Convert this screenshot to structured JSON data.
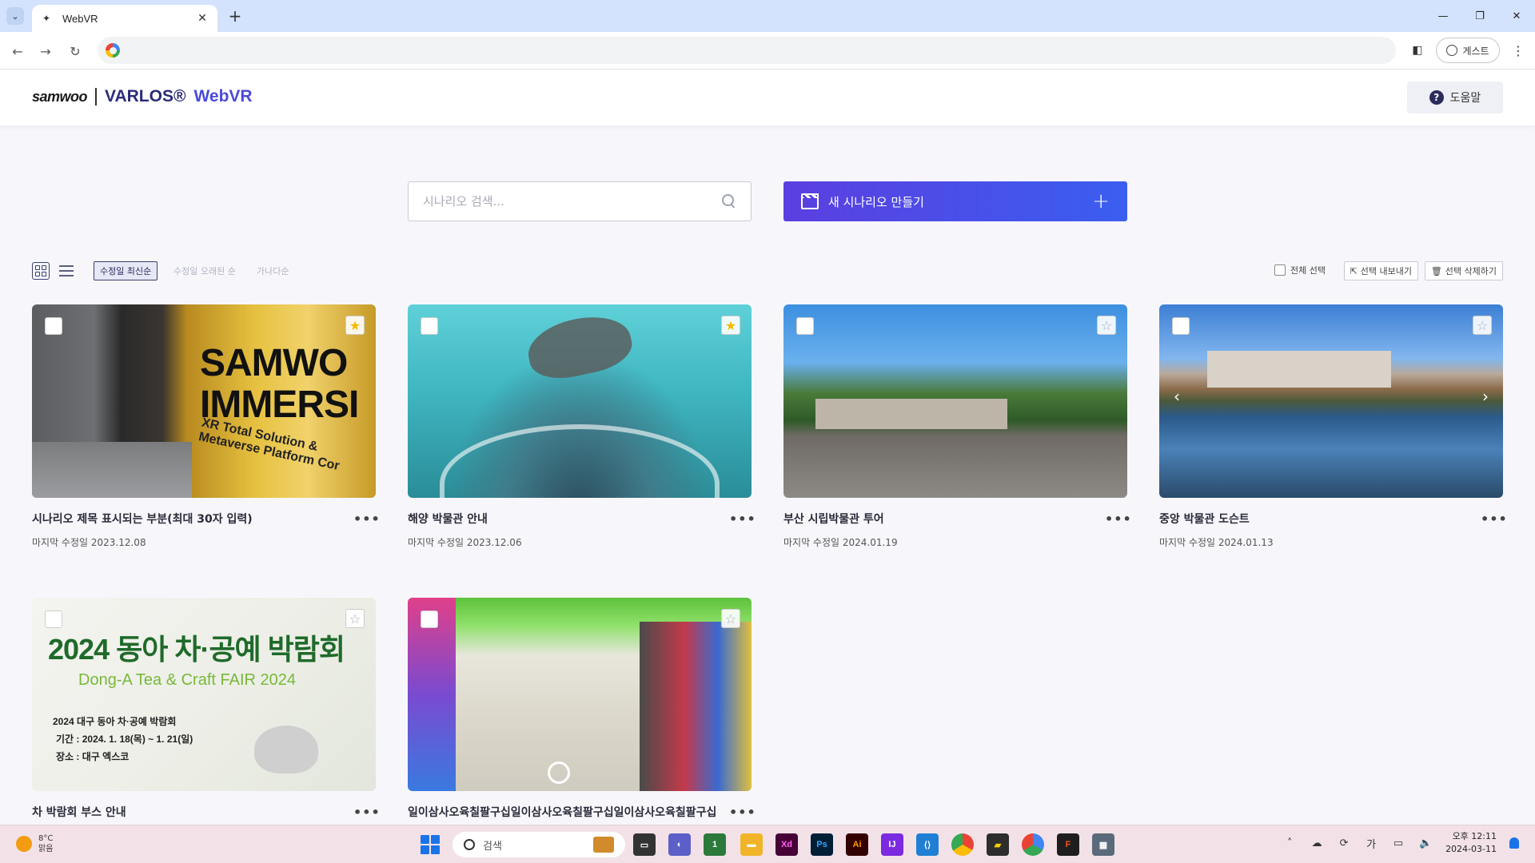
{
  "browser": {
    "tab_title": "WebVR",
    "profile_label": "게스트"
  },
  "app": {
    "brand_logo": "samwoo",
    "brand_name": "VARLOS®",
    "brand_product": "WebVR",
    "help_label": "도움말"
  },
  "search": {
    "placeholder": "시나리오 검색..."
  },
  "create_button": {
    "label": "새 시나리오 만들기"
  },
  "sort_options": [
    "수정일 최신순",
    "수정일 오래된 순",
    "가나다순"
  ],
  "bulk_actions": {
    "select_all": "전체 선택",
    "export": "선택 내보내기",
    "delete": "선택 삭제하기"
  },
  "scenarios": [
    {
      "title": "시나리오 제목 표시되는 부분(최대 30자 입력)",
      "date": "마지막 수정일 2023.12.08",
      "starred": true,
      "thumb_text": "SAMWO IMMERSI",
      "thumb_sub": "XR Total Solution & Metaverse Platform Cor"
    },
    {
      "title": "해양 박물관 안내",
      "date": "마지막 수정일 2023.12.06",
      "starred": true
    },
    {
      "title": "부산 시립박물관 투어",
      "date": "마지막 수정일 2024.01.19",
      "starred": false
    },
    {
      "title": "중앙 박물관 도슨트",
      "date": "마지막 수정일 2024.01.13",
      "starred": false
    },
    {
      "title": "차 박람회 부스 안내",
      "date": "",
      "starred": false,
      "thumb_text": "2024 동아 차·공예 박람회",
      "thumb_sub": "Dong-A Tea & Craft FAIR 2024",
      "thumb_line1": "2024 대구 동아 차·공예 박람회",
      "thumb_line2": "기간 : 2024. 1. 18(목) ~ 1. 21(일)",
      "thumb_line3": "장소 : 대구 엑스코"
    },
    {
      "title": "일이삼사오육칠팔구십일이삼사오육칠팔구십일이삼사오육칠팔구십",
      "date": "",
      "starred": false
    }
  ],
  "taskbar": {
    "weather_temp": "8°C",
    "weather_desc": "맑음",
    "search_label": "검색",
    "ime_label": "가",
    "time": "오후 12:11",
    "date": "2024-03-11",
    "badge_count": "1"
  },
  "colors": {
    "accent": "#4a4ad8",
    "create_gradient_start": "#5b3fe0",
    "create_gradient_end": "#3a5ef0",
    "star_on": "#f5b800"
  }
}
